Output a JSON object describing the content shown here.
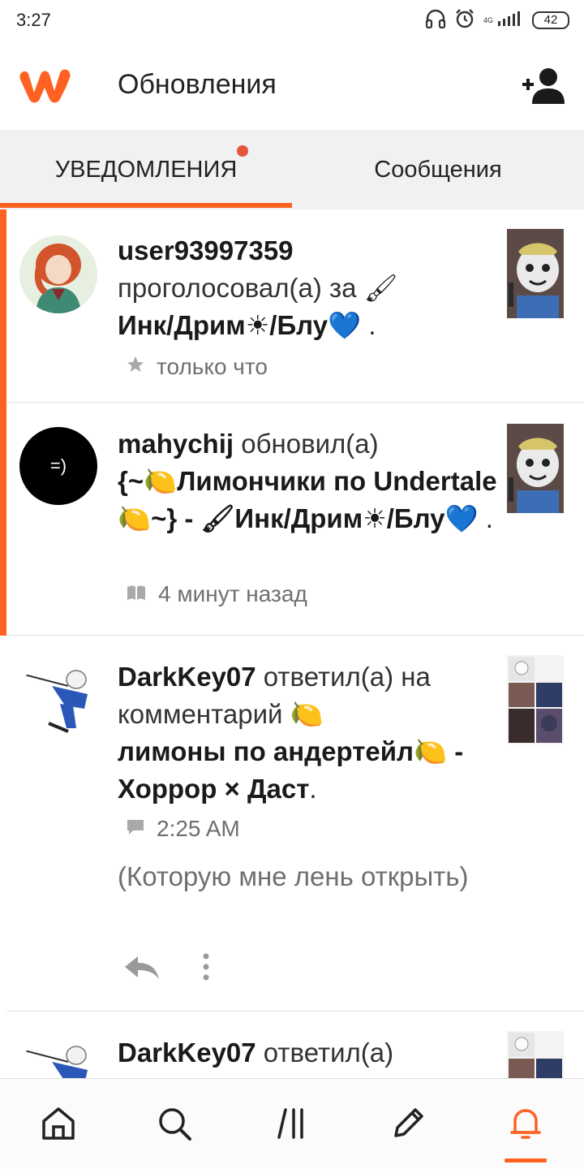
{
  "status_bar": {
    "time": "3:27",
    "network": "4G",
    "battery": "42"
  },
  "header": {
    "title": "Обновления"
  },
  "tabs": [
    {
      "label": "УВЕДОМЛЕНИЯ",
      "active": true,
      "has_dot": true
    },
    {
      "label": "Сообщения",
      "active": false
    }
  ],
  "notifications": [
    {
      "user": "user93997359",
      "action": "проголосовал(а) за",
      "story_pre": "🖌",
      "story": "Инк/Дрим☀/Блу💙",
      "suffix": " .",
      "meta_icon": "star-icon",
      "time": "только что"
    },
    {
      "user": "mahychij",
      "action": "обновил(а)",
      "avatar_text": "=)",
      "story": "{~🍋Лимончики по Undertale 🍋~} - 🖌Инк/Дрим☀/Блу💙",
      "suffix": " .",
      "meta_icon": "book-icon",
      "time": "4 минут назад"
    },
    {
      "user": "DarkKey07",
      "action": "ответил(а) на комментарий 🍋",
      "story": "лимоны по андертейл🍋 - Хоррор × Даст",
      "suffix": ".",
      "meta_icon": "comment-icon",
      "time": "2:25 AM",
      "quote": "(Которую мне лень открыть)"
    },
    {
      "user": "DarkKey07",
      "action": "ответил(а)"
    }
  ],
  "colors": {
    "accent": "#ff6122",
    "dot": "#e4553c"
  }
}
